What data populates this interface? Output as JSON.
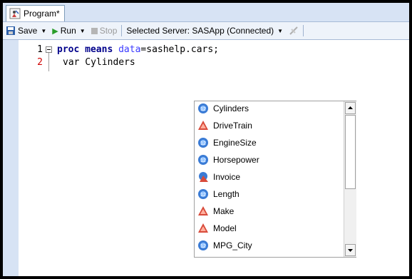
{
  "tab": {
    "label": "Program*"
  },
  "toolbar": {
    "save": "Save",
    "run": "Run",
    "stop": "Stop",
    "server": "Selected Server: SASApp (Connected)"
  },
  "editor": {
    "lines": [
      {
        "number": "1",
        "tokens": [
          "proc means",
          " data",
          "=sashelp.cars;"
        ]
      },
      {
        "number": "2",
        "text": "var Cylinders"
      }
    ]
  },
  "autocomplete": {
    "items": [
      {
        "label": "Cylinders",
        "icon": "numeric-variable-icon"
      },
      {
        "label": "DriveTrain",
        "icon": "character-variable-icon"
      },
      {
        "label": "EngineSize",
        "icon": "numeric-variable-icon"
      },
      {
        "label": "Horsepower",
        "icon": "numeric-variable-icon"
      },
      {
        "label": "Invoice",
        "icon": "currency-variable-icon"
      },
      {
        "label": "Length",
        "icon": "numeric-variable-icon"
      },
      {
        "label": "Make",
        "icon": "character-variable-icon"
      },
      {
        "label": "Model",
        "icon": "character-variable-icon"
      },
      {
        "label": "MPG_City",
        "icon": "numeric-variable-icon"
      }
    ]
  },
  "colors": {
    "keyword": "#00008b",
    "option": "#3b3bff",
    "numeric_icon": "#3a7bd5",
    "character_icon": "#d84a3a"
  }
}
